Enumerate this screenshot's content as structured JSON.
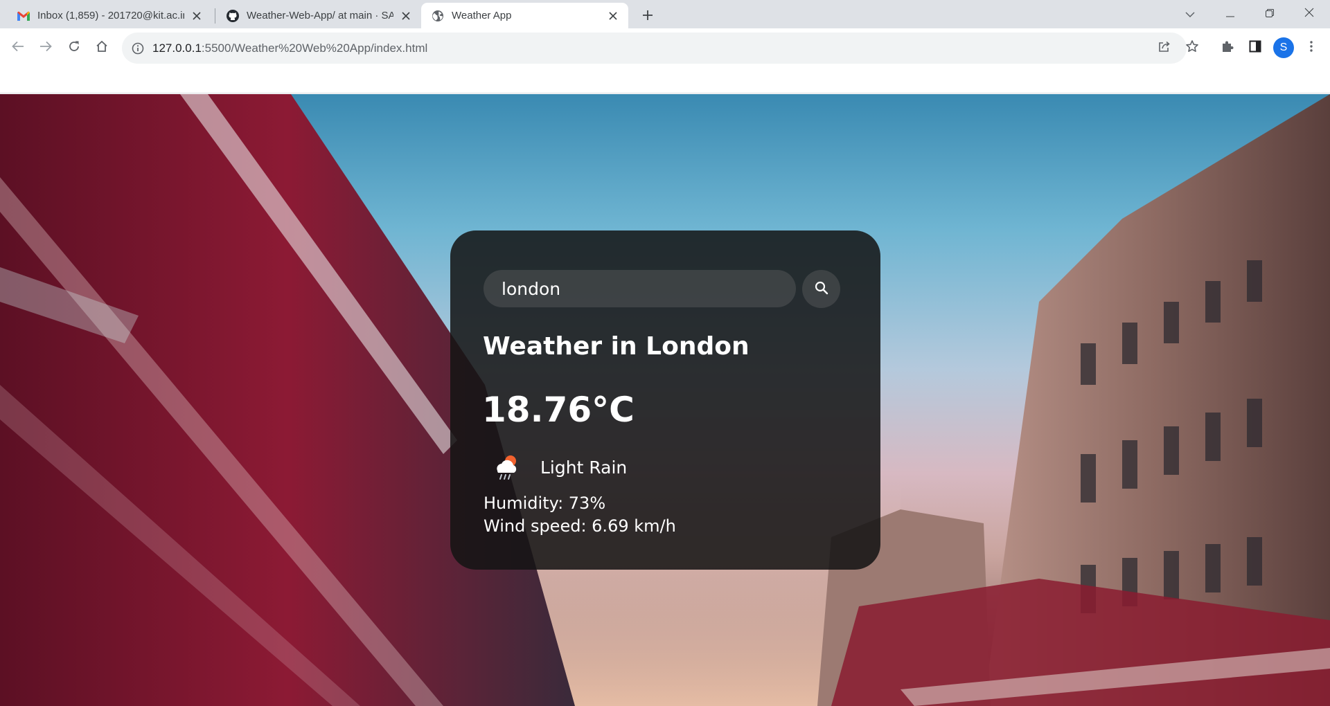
{
  "browser": {
    "tabs": [
      {
        "title": "Inbox (1,859) - 201720@kit.ac.in",
        "favicon": "gmail-icon",
        "active": false
      },
      {
        "title": "Weather-Web-App/ at main · SA",
        "favicon": "github-icon",
        "active": false
      },
      {
        "title": "Weather App",
        "favicon": "globe-icon",
        "active": true
      }
    ],
    "url_host": "127.0.0.1",
    "url_path": ":5500/Weather%20Web%20App/index.html",
    "profile_initial": "S",
    "colors": {
      "accent": "#1a73e8",
      "tabstrip": "#dee1e6"
    }
  },
  "weather": {
    "search_value": "london",
    "search_placeholder": "Search",
    "city_heading": "Weather in London",
    "temperature": "18.76°C",
    "description": "Light Rain",
    "icon": "cloud-rain-sun-icon",
    "humidity": "Humidity: 73%",
    "wind": "Wind speed: 6.69 km/h"
  }
}
